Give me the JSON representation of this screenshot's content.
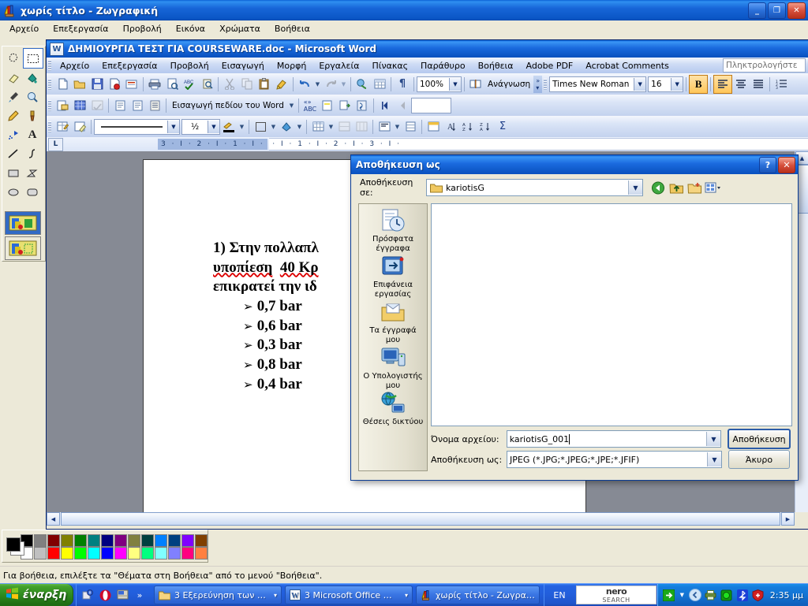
{
  "paint": {
    "title": "χωρίς τίτλο - Ζωγραφική",
    "icon": "paint-palette-icon",
    "menu": [
      "Αρχείο",
      "Επεξεργασία",
      "Προβολή",
      "Εικόνα",
      "Χρώματα",
      "Βοήθεια"
    ],
    "window_buttons": {
      "minimize": "_",
      "restore": "❐",
      "close": "✕"
    },
    "status_text": "Για βοήθεια, επιλέξτε τα \"Θέματα στη Βοήθεια\" από το μενού \"Βοήθεια\".",
    "tools": [
      "free-form-select-icon",
      "rectangular-select-icon",
      "eraser-icon",
      "fill-with-color-icon",
      "pick-color-icon",
      "magnifier-icon",
      "pencil-icon",
      "brush-icon",
      "airbrush-icon",
      "text-icon",
      "line-icon",
      "curve-icon",
      "rectangle-icon",
      "polygon-icon",
      "ellipse-icon",
      "rounded-rectangle-icon"
    ],
    "foreground_color": "#000000",
    "background_color": "#ffffff",
    "palette_row1": [
      "#000000",
      "#808080",
      "#800000",
      "#808000",
      "#008000",
      "#008080",
      "#000080",
      "#800080",
      "#808040",
      "#004040",
      "#0080ff",
      "#004080",
      "#8000ff",
      "#804000"
    ],
    "palette_row2": [
      "#ffffff",
      "#c0c0c0",
      "#ff0000",
      "#ffff00",
      "#00ff00",
      "#00ffff",
      "#0000ff",
      "#ff00ff",
      "#ffff80",
      "#00ff80",
      "#80ffff",
      "#8080ff",
      "#ff0080",
      "#ff8040"
    ]
  },
  "word": {
    "title": "ΔΗΜΙΟΥΡΓΙΑ ΤΕΣΤ ΓΙΑ COURSEWARE.doc - Microsoft Word",
    "icon": "word-document-icon",
    "menu": [
      "Αρχείο",
      "Επεξεργασία",
      "Προβολή",
      "Εισαγωγή",
      "Μορφή",
      "Εργαλεία",
      "Πίνακας",
      "Παράθυρο",
      "Βοήθεια",
      "Adobe PDF",
      "Acrobat Comments"
    ],
    "ask_a_question_placeholder": "Πληκτρολογήστε",
    "standard_toolbar": [
      "new-document-icon",
      "open-icon",
      "save-icon",
      "permission-icon",
      "mail-recipient-icon",
      "print-icon",
      "print-preview-icon",
      "spelling-check-icon",
      "research-icon",
      "cut-icon",
      "copy-icon",
      "paste-icon",
      "format-painter-icon",
      "undo-icon",
      "redo-icon",
      "insert-hyperlink-icon",
      "insert-table-icon",
      "show-formatting-marks-icon"
    ],
    "zoom_value": "100%",
    "reading_label": "Ανάγνωση",
    "font_name": "Times New Roman",
    "font_size": "16",
    "bold_label": "B",
    "bold_active": true,
    "align_left_active": true,
    "mailmerge_toolbar_label": "Εισαγωγή πεδίου του Word",
    "line_width": "½",
    "ruler_left_numbers": "3 · I · 2 · I · 1 · I ·",
    "ruler_right_numbers": "· I · 1 · I · 2 · I · 3 · I ·",
    "tab_marker": "L",
    "document": {
      "line1": "1) Στην πολλαπλ",
      "line2_a": "υποπίεση",
      "line2_b": "40 Κρ",
      "line3": "επικρατεί την ιδ",
      "bullet_glyph": "➢",
      "bullets": [
        "0,7 bar",
        "0,6 bar",
        "0,3 bar",
        "0,8 bar",
        "0,4 bar"
      ]
    }
  },
  "save_dialog": {
    "title": "Αποθήκευση ως",
    "help_button": "?",
    "close_button": "✕",
    "save_in_label": "Αποθήκευση σε:",
    "save_in_value": "kariotisG",
    "nav_buttons": [
      "back-icon",
      "up-one-level-icon",
      "create-new-folder-icon",
      "views-icon"
    ],
    "places": [
      {
        "icon": "recent-documents-icon",
        "label": "Πρόσφατα\nέγγραφα"
      },
      {
        "icon": "desktop-icon",
        "label": "Επιφάνεια\nεργασίας"
      },
      {
        "icon": "my-documents-icon",
        "label": "Τα έγγραφά\nμου"
      },
      {
        "icon": "my-computer-icon",
        "label": "Ο Υπολογιστής\nμου"
      },
      {
        "icon": "my-network-places-icon",
        "label": "Θέσεις δικτύου"
      }
    ],
    "file_list_items": [],
    "file_name_label": "Όνομα αρχείου:",
    "file_name_value": "kariotisG_001",
    "save_as_type_label": "Αποθήκευση ως:",
    "save_as_type_value": "JPEG (*.JPG;*.JPEG;*.JPE;*.JFIF)",
    "save_button": "Αποθήκευση",
    "cancel_button": "Άκυρο"
  },
  "taskbar": {
    "start_label": "έναρξη",
    "quick_launch": [
      "security-center-icon",
      "opera-icon",
      "show-desktop-icon",
      "chevron-double-right-icon"
    ],
    "tasks": [
      {
        "icon": "folder-icon",
        "label": "3 Εξερεύνηση των …",
        "count": "3",
        "has_chevron": true
      },
      {
        "icon": "word-icon",
        "label": "3 Microsoft Office …",
        "count": "3",
        "has_chevron": true
      },
      {
        "icon": "paint-icon",
        "label": "χωρίς τίτλο - Ζωγραφ…",
        "count": "",
        "has_chevron": false
      }
    ],
    "language": "EN",
    "nero_line1": "nero",
    "nero_line2": "SEARCH",
    "tray_icons": [
      "go-arrow-icon",
      "chevron-down-icon",
      "hide-icons-icon",
      "printer-icon",
      "antivirus-icon",
      "bluetooth-icon",
      "security-shield-icon"
    ],
    "clock": "2:35 μμ"
  }
}
